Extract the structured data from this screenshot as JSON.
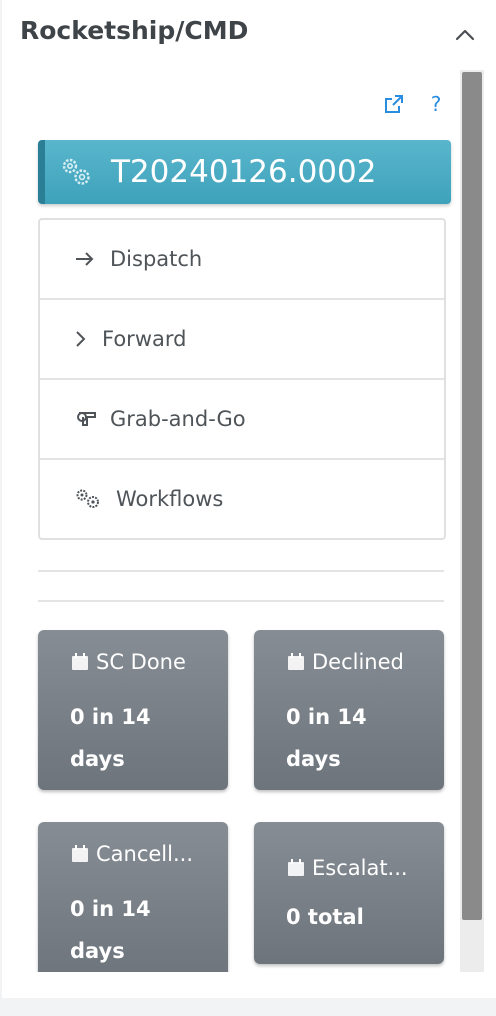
{
  "panel": {
    "title": "Rocketship/CMD",
    "collapse_icon": "chevron-up-icon"
  },
  "toolbar": {
    "open_external_icon": "external-link-icon",
    "help_label": "?"
  },
  "ticket": {
    "id": "T20240126.0002",
    "icon": "gears-icon",
    "accent": "#4aa9c1"
  },
  "menu": {
    "items": [
      {
        "label": "Dispatch",
        "icon": "arrow-right-icon"
      },
      {
        "label": "Forward",
        "icon": "chevron-right-icon"
      },
      {
        "label": "Grab-and-Go",
        "icon": "grab-icon"
      },
      {
        "label": "Workflows",
        "icon": "gears-icon"
      }
    ]
  },
  "cards": [
    {
      "title": "SC Done",
      "value": "0 in 14 days",
      "icon": "calendar-icon"
    },
    {
      "title": "Declined",
      "value": "0 in 14 days",
      "icon": "calendar-icon"
    },
    {
      "title": "Cancell...",
      "value": "0 in 14 days",
      "icon": "calendar-icon"
    },
    {
      "title": "Escalat...",
      "value": "0 total",
      "icon": "calendar-icon"
    }
  ],
  "colors": {
    "card_bg": "#7a8188",
    "link": "#2b8de0"
  }
}
